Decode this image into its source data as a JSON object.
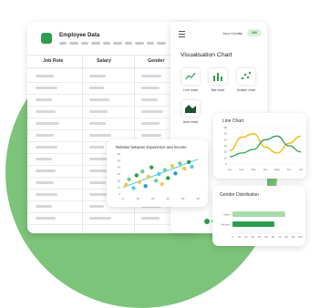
{
  "sheet": {
    "title": "Employee Data",
    "columns": [
      "Job Role",
      "Salary",
      "Gender"
    ]
  },
  "panel": {
    "credits_label": "Your Credits",
    "credits_value": "200",
    "title": "Visualisation Chart",
    "chart_types": [
      {
        "label": "Line chart",
        "icon": "line-chart-icon"
      },
      {
        "label": "Bar chart",
        "icon": "bar-chart-icon"
      },
      {
        "label": "Scatter chart",
        "icon": "scatter-chart-icon"
      },
      {
        "label": "Area chart",
        "icon": "area-chart-icon"
      }
    ],
    "brand_partial": "P"
  },
  "chart_data": [
    {
      "type": "scatter",
      "title": "Relation between Experience and Income",
      "xlim": [
        0,
        50
      ],
      "ylim": [
        0,
        60
      ],
      "x_ticks": [
        "0",
        "10",
        "20",
        "30",
        "40",
        "50"
      ],
      "y_ticks": [
        "0",
        "10",
        "20",
        "30",
        "40",
        "50",
        "60"
      ],
      "points": [
        {
          "x": 2,
          "y": 14,
          "color": "#f2c94c"
        },
        {
          "x": 4,
          "y": 22,
          "color": "#6fcf97"
        },
        {
          "x": 7,
          "y": 9,
          "color": "#56ccf2"
        },
        {
          "x": 9,
          "y": 28,
          "color": "#2f9e4e"
        },
        {
          "x": 11,
          "y": 18,
          "color": "#f2c94c"
        },
        {
          "x": 13,
          "y": 34,
          "color": "#6fcf97"
        },
        {
          "x": 15,
          "y": 12,
          "color": "#2d9cdb"
        },
        {
          "x": 17,
          "y": 26,
          "color": "#f2c94c"
        },
        {
          "x": 19,
          "y": 40,
          "color": "#2f9e4e"
        },
        {
          "x": 22,
          "y": 20,
          "color": "#6fcf97"
        },
        {
          "x": 24,
          "y": 30,
          "color": "#56ccf2"
        },
        {
          "x": 26,
          "y": 15,
          "color": "#f2c94c"
        },
        {
          "x": 28,
          "y": 36,
          "color": "#6fcf97"
        },
        {
          "x": 30,
          "y": 24,
          "color": "#2f9e4e"
        },
        {
          "x": 33,
          "y": 42,
          "color": "#f2c94c"
        },
        {
          "x": 35,
          "y": 31,
          "color": "#2d9cdb"
        },
        {
          "x": 38,
          "y": 46,
          "color": "#6fcf97"
        },
        {
          "x": 41,
          "y": 38,
          "color": "#f2c94c"
        },
        {
          "x": 44,
          "y": 48,
          "color": "#2f9e4e"
        },
        {
          "x": 46,
          "y": 41,
          "color": "#56ccf2"
        }
      ],
      "trend": [
        [
          0,
          10
        ],
        [
          50,
          52
        ]
      ],
      "trend_color": "#56ccf2"
    },
    {
      "type": "line",
      "title": "Line Chart",
      "x_ticks": [
        "Jan",
        "Feb",
        "Mar",
        "Apr",
        "May",
        "Jun",
        "Jul"
      ],
      "y_ticks": [
        "60",
        "50",
        "40",
        "30",
        "20",
        "10",
        "0"
      ],
      "ylim": [
        0,
        60
      ],
      "series": [
        {
          "color": "#f2b705",
          "values": [
            22,
            44,
            50,
            28,
            18,
            34,
            46
          ]
        },
        {
          "color": "#2f9e4e",
          "values": [
            12,
            18,
            24,
            40,
            46,
            30,
            20
          ]
        }
      ]
    },
    {
      "type": "bar",
      "title": "Gender Distribution",
      "orientation": "horizontal",
      "categories": [
        "Male",
        "Female"
      ],
      "values": [
        78,
        62
      ],
      "colors": [
        "#a8dba8",
        "#2f9e4e"
      ],
      "xlim": [
        0,
        100
      ],
      "x_ticks": [
        "0",
        "10",
        "20",
        "30",
        "40",
        "50",
        "60",
        "70",
        "80",
        "90",
        "100"
      ]
    }
  ]
}
